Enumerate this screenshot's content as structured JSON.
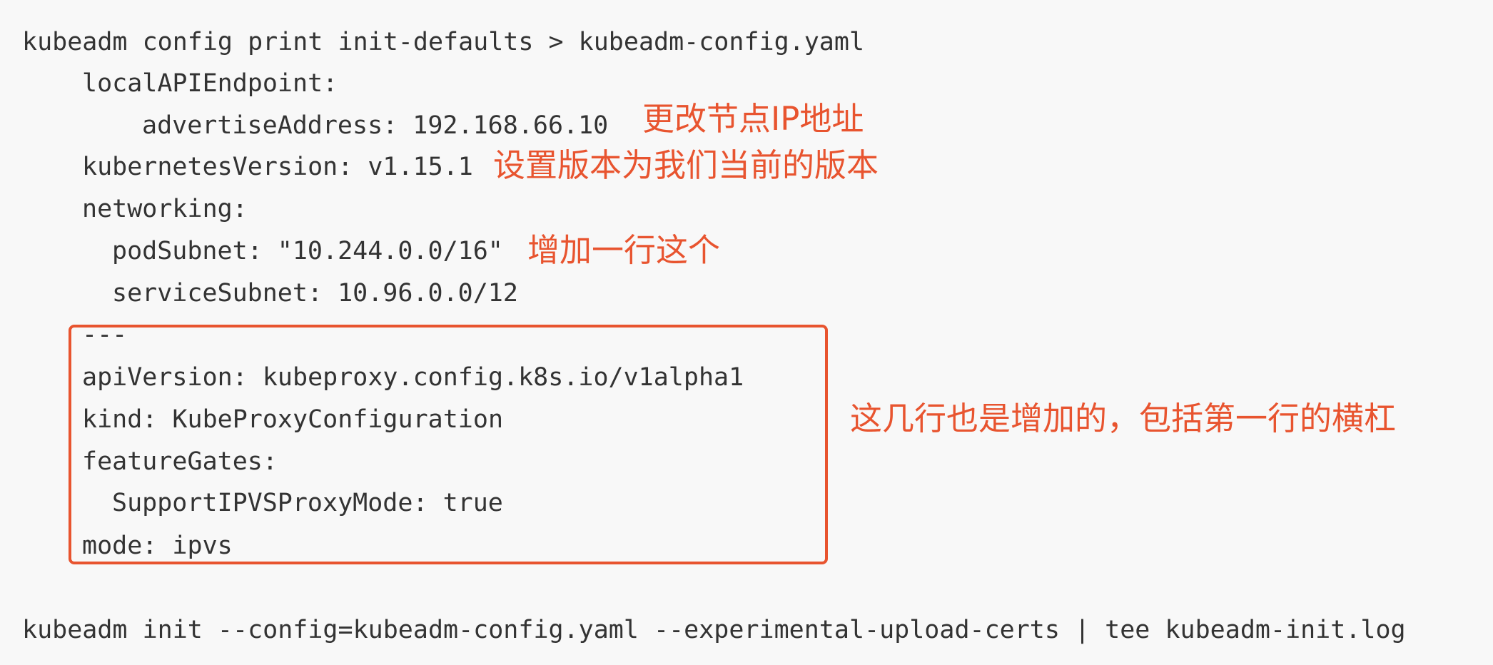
{
  "code": {
    "command_export": "kubeadm config print init-defaults > kubeadm-config.yaml",
    "local_api_endpoint": "localAPIEndpoint:",
    "advertise_address": "advertiseAddress: 192.168.66.10",
    "kubernetes_version": "kubernetesVersion: v1.15.1",
    "networking": "networking:",
    "pod_subnet": "podSubnet: \"10.244.0.0/16\"",
    "service_subnet": "serviceSubnet: 10.96.0.0/12",
    "separator": "---",
    "api_version": "apiVersion: kubeproxy.config.k8s.io/v1alpha1",
    "kind": "kind: KubeProxyConfiguration",
    "feature_gates": "featureGates:",
    "support_ipvs": "SupportIPVSProxyMode: true",
    "mode": "mode: ipvs",
    "command_init": "kubeadm init --config=kubeadm-config.yaml --experimental-upload-certs | tee kubeadm-init.log"
  },
  "annotations": {
    "change_ip": "更改节点IP地址",
    "set_version": "设置版本为我们当前的版本",
    "add_line": "增加一行这个",
    "added_block": "这几行也是增加的，包括第一行的横杠"
  },
  "colors": {
    "annotation": "#e8542f",
    "code_text": "#333333",
    "background": "#f8f8f8"
  }
}
